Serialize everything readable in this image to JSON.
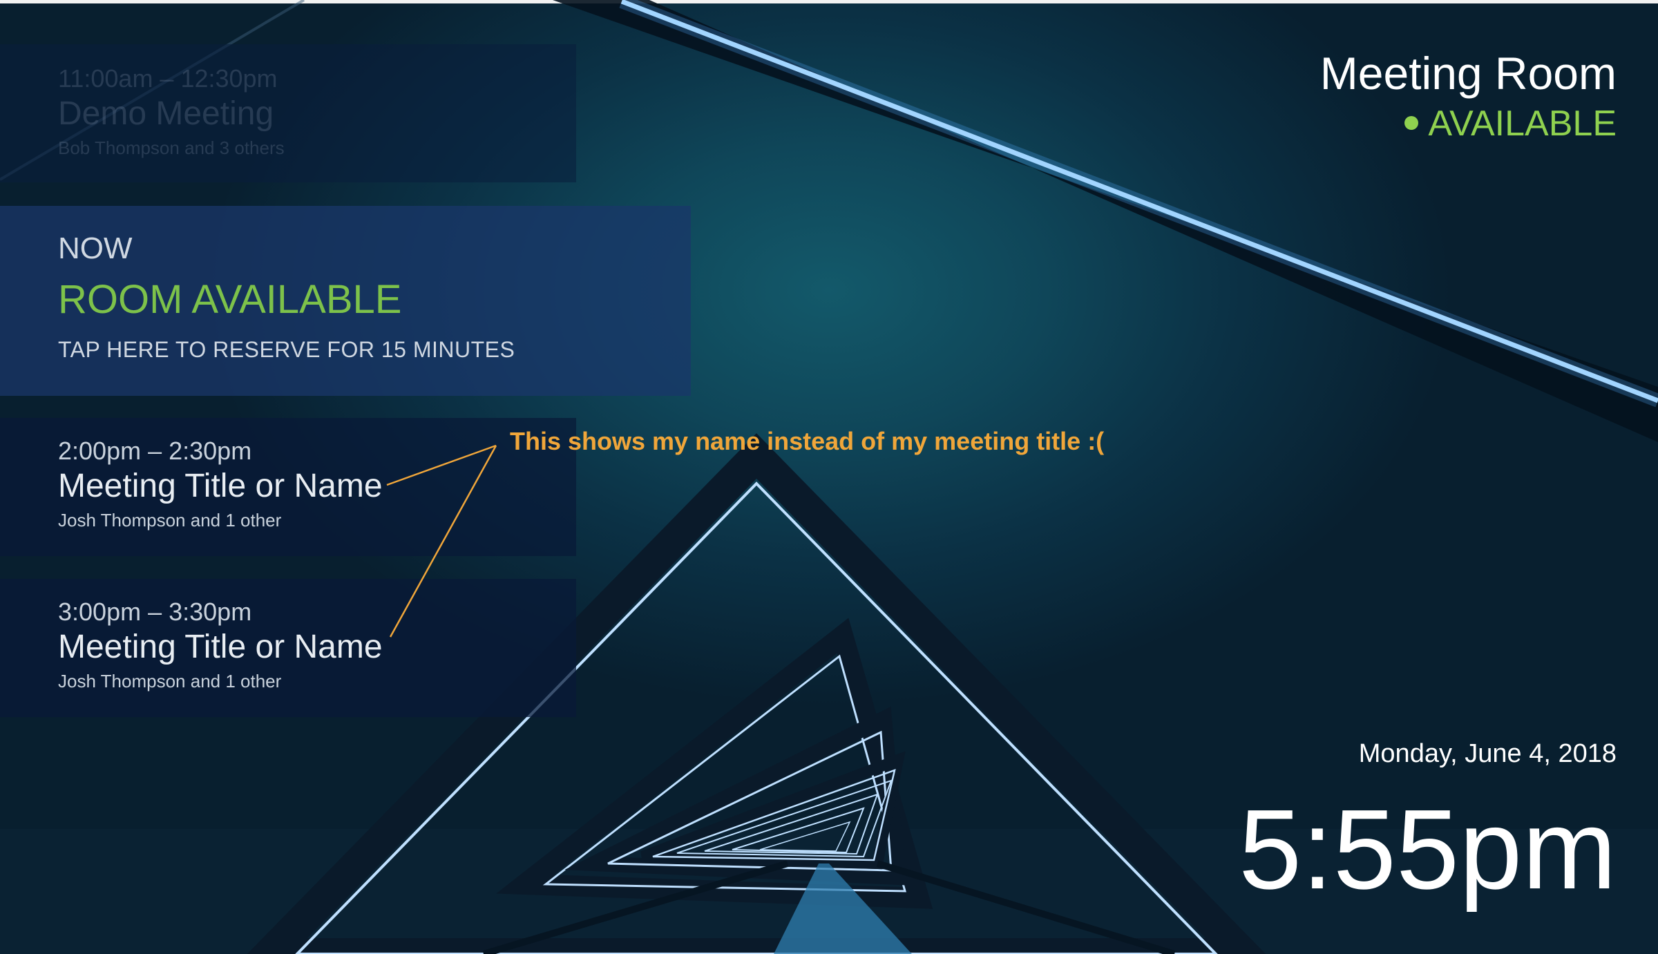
{
  "room": {
    "name": "Meeting Room",
    "status": "AVAILABLE"
  },
  "past_meeting": {
    "time": "11:00am – 12:30pm",
    "title": "Demo Meeting",
    "attendees": "Bob Thompson and 3 others"
  },
  "now": {
    "label": "NOW",
    "status": "ROOM AVAILABLE",
    "action": "TAP HERE TO RESERVE FOR 15 MINUTES"
  },
  "upcoming": [
    {
      "time": "2:00pm – 2:30pm",
      "title": "Meeting Title or Name",
      "attendees": "Josh Thompson and 1 other"
    },
    {
      "time": "3:00pm – 3:30pm",
      "title": "Meeting Title or Name",
      "attendees": "Josh Thompson and 1 other"
    }
  ],
  "datetime": {
    "date": "Monday, June 4, 2018",
    "time": "5:55pm"
  },
  "annotation": {
    "text": "This shows my name instead of my meeting title :("
  },
  "colors": {
    "available_green": "#8fd14f",
    "annotation_orange": "#f0a63a",
    "panel_now": "#19376a"
  }
}
